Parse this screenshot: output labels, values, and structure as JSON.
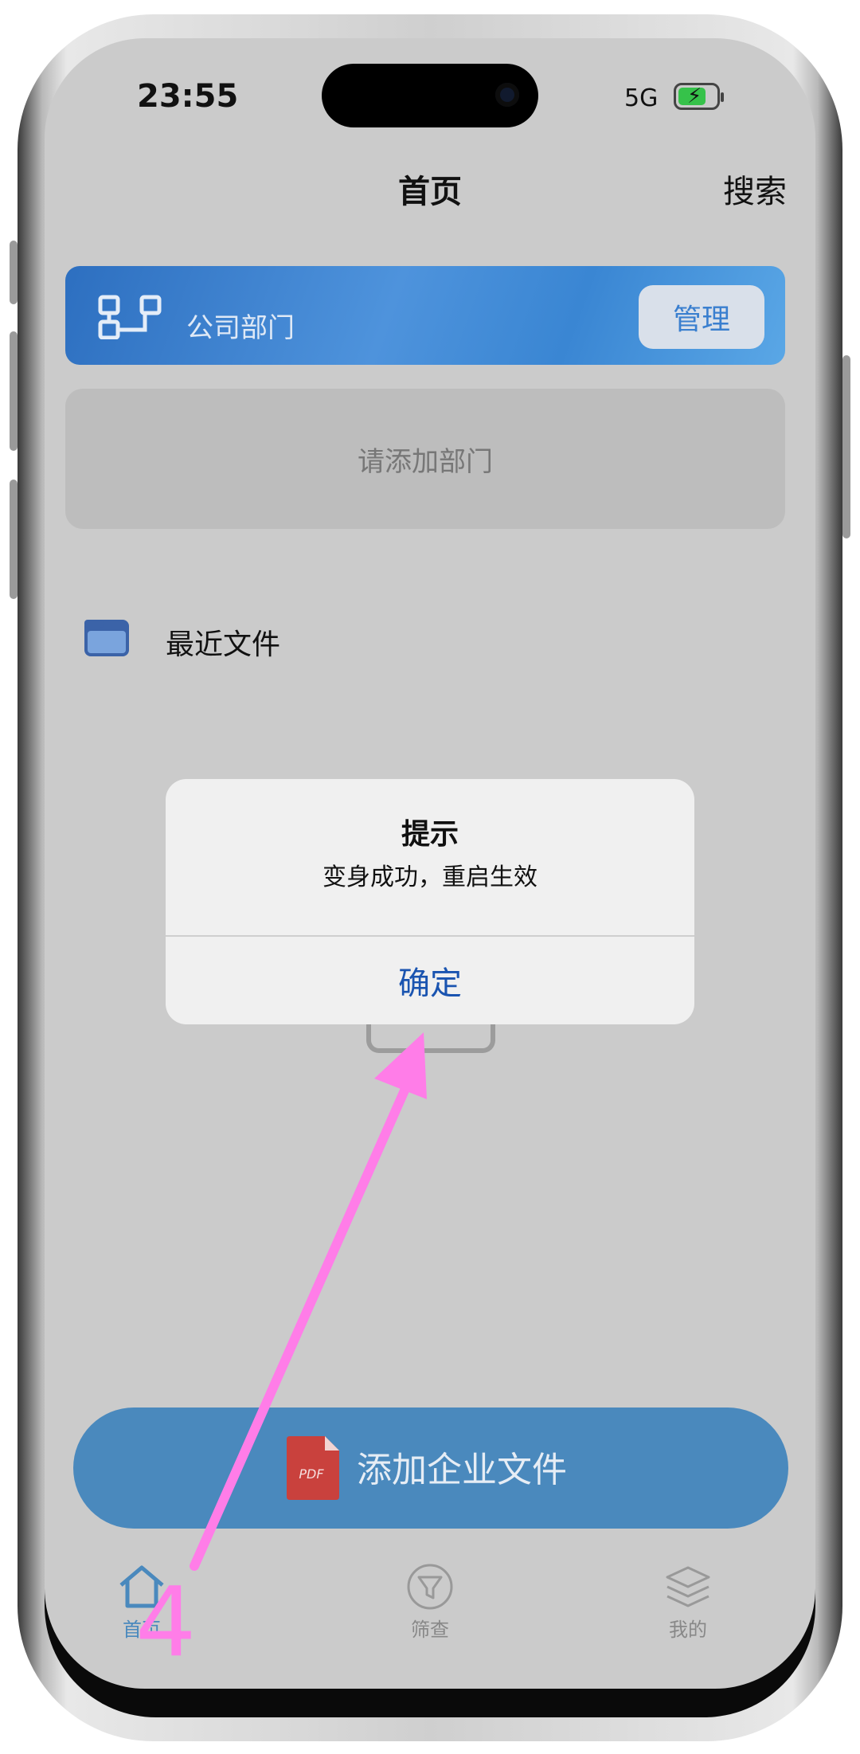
{
  "status": {
    "time": "23:55",
    "network": "5G"
  },
  "nav": {
    "title": "首页",
    "search": "搜索"
  },
  "department": {
    "label": "公司部门",
    "manage_label": "管理",
    "empty_text": "请添加部门"
  },
  "recent": {
    "label": "最近文件"
  },
  "dialog": {
    "title": "提示",
    "message": "变身成功，重启生效",
    "confirm_label": "确定"
  },
  "cta": {
    "label": "添加企业文件",
    "icon": "pdf-icon",
    "icon_text": "PDF"
  },
  "tabs": [
    {
      "label": "首页",
      "icon": "home-icon"
    },
    {
      "label": "筛查",
      "icon": "filter-icon"
    },
    {
      "label": "我的",
      "icon": "layers-icon"
    }
  ],
  "annotation": {
    "step_number": "4",
    "color": "#ff7de8"
  },
  "colors": {
    "accent": "#4a89bd",
    "dialog_button": "#1a54b0",
    "banner": "#3a86d3"
  }
}
